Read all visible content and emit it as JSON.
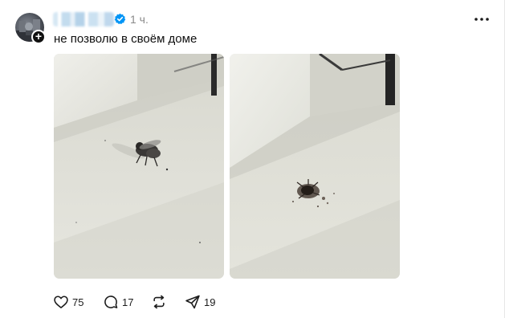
{
  "post": {
    "author": {
      "username": "redacted",
      "avatar_icon": "avatar-photo",
      "follow_icon": "plus-icon",
      "verified_icon": "verified-badge-icon"
    },
    "timestamp": "1 ч.",
    "more_icon": "more-horizontal-icon",
    "text": "не позволю в своём доме",
    "images": [
      {
        "alt": "fly-on-white-shelf"
      },
      {
        "alt": "squashed-fly-on-white-shelf"
      }
    ],
    "actions": {
      "likes": "75",
      "replies": "17",
      "reposts": "",
      "shares": "19"
    }
  },
  "colors": {
    "text": "#101010",
    "muted": "#8a8a8a",
    "verified": "#0095f6",
    "background": "#ffffff"
  }
}
